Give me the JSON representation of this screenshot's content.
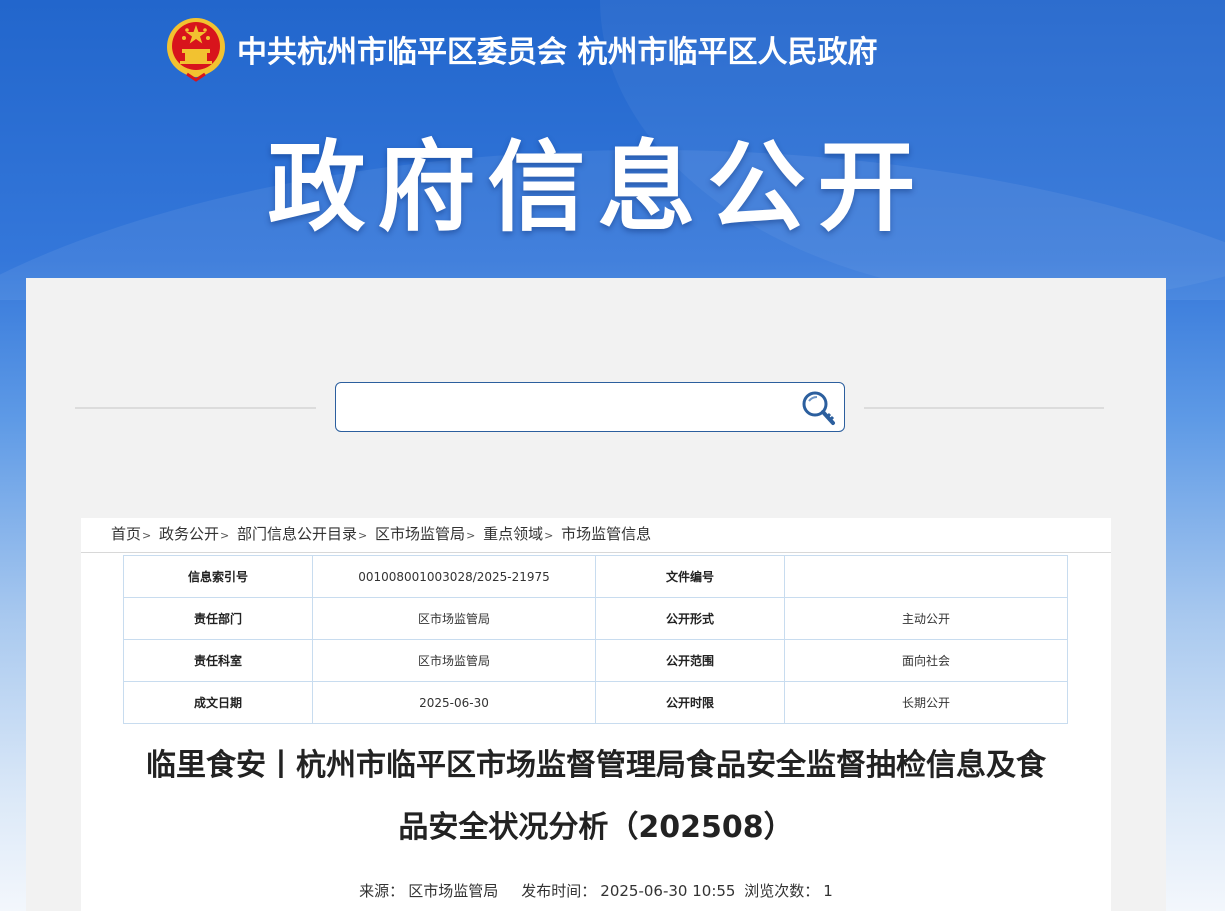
{
  "header": {
    "org_name": "中共杭州市临平区委员会  杭州市临平区人民政府",
    "title": "政府信息公开",
    "emblem_icon": "national-emblem-icon"
  },
  "search": {
    "placeholder": "",
    "value": "",
    "icon": "search-icon"
  },
  "breadcrumb": [
    "首页",
    "政务公开",
    "部门信息公开目录",
    "区市场监管局",
    "重点领域",
    "市场监管信息"
  ],
  "info_table": {
    "rows": [
      [
        {
          "label": "信息索引号",
          "value": "001008001003028/2025-21975"
        },
        {
          "label": "文件编号",
          "value": ""
        }
      ],
      [
        {
          "label": "责任部门",
          "value": "区市场监管局"
        },
        {
          "label": "公开形式",
          "value": "主动公开"
        }
      ],
      [
        {
          "label": "责任科室",
          "value": "区市场监管局"
        },
        {
          "label": "公开范围",
          "value": "面向社会"
        }
      ],
      [
        {
          "label": "成文日期",
          "value": "2025-06-30"
        },
        {
          "label": "公开时限",
          "value": "长期公开"
        }
      ]
    ]
  },
  "article": {
    "title_line1": "临里食安丨杭州市临平区市场监督管理局食品安全监督抽检信息及食",
    "title_line2": "品安全状况分析（202508）",
    "source_label": "来源：",
    "source": "区市场监管局",
    "publish_label": "发布时间：",
    "publish_time": "2025-06-30 10:55",
    "views_label": "浏览次数：",
    "views": "1"
  },
  "colors": {
    "banner_blue": "#2266cc",
    "search_border": "#2c5f9e",
    "emblem_red": "#d8141c",
    "emblem_gold": "#f2c230"
  }
}
